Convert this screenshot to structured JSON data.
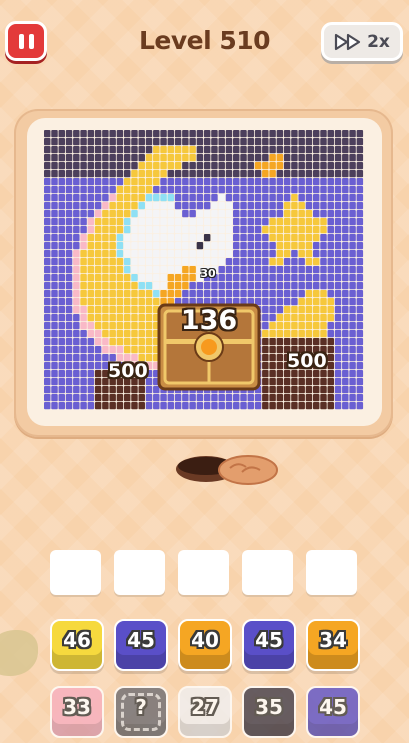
{
  "header": {
    "level_title": "Level 510",
    "speed_label": "2x",
    "pause_icon": "pause-icon",
    "speed_icon": "fast-forward-icon"
  },
  "board": {
    "palette": {
      "D": "#4c3f5c",
      "B": "#6a5fd2",
      "Y": "#f6c83c",
      "O": "#f5a623",
      "P": "#f9b9c7",
      "W": "#f4f4f6",
      "C": "#8fe0f4",
      "K": "#3a3348",
      "M": "#5a2f25",
      "G": "#d8a75a"
    },
    "rows": [
      "DDDDDDDDDDDDDDDDDDDDDDDDDDDDDDDDDDDDDDDDDDDD",
      "DDDDDDDDDDDDDDDDDDDDDDDDDDDDDDDDDDDDDDDDDDDD",
      "DDDDDDDDDDDDDDDYYYYYYDDDDDDDDDDDDDDDDDDDDDDD",
      "DDDDDDDDDDDDDDYYYYYYYDDDDDDDDDDOODDDDDDDDDDD",
      "DDDDDDDDDDDDDYYYYYYDDDDDDDDDDOOOODDDDDDDDDDD",
      "DDDDDDDDDDDDYYYYYDDDDDDDDDDDDDOODDDDDDDDDDDD",
      "BBBBBBBBBBBYYYYYBBBBBBBBBBBBBBBBBBBBBBBBBBBB",
      "BBBBBBBBBBYYYYYBBBBBBBBBBBBBBBBBBBBBBBBBBBBB",
      "BBBBBBBBBPYYYYCCCCBBBBBBWBBBBBBBBBYBBBBBBBBB",
      "BBBBBBBBPYYYYCWWWWBBBBBWWWBBBBBBBYYYBBBBBBBB",
      "BBBBBBBPYYYYCWWWWWWBBWWWWWBBBBBBBYYYYBBBBBBB",
      "BBBBBBPYYYYCWWWWWWWWWWWWWWBBBBBYYYYYYYYBBBBB",
      "BBBBBBPYYYYCWWWWWWWWWWWWWWBBBBYYYYYYYYYBBBBB",
      "BBBBBPYYYYCWWWWWWWWWWWKWWWBBBBBYYYYYYYBBBBBB",
      "BBBBBPYYYYCWWWWWWWWWWKWWWWBBBBBBYYYYYBBBBBBB",
      "BBBBPYYYYYCWWWWWWWWWWWWWWWBBBBBBYYBYYBBBBBBB",
      "BBBBPYYYYYYCWWWWWWWWWWWWWBBBBBBYYBBBYYBBBBBB",
      "BBBBPYYYYYYCWWWWWWWOOWWWBBBBBBBBBBBBBBBBBBBB",
      "BBBBPYYYYYYYCWWWWOOOOWBBBBBBBBBBBBBBBBBBBBBB",
      "BBBBPYYYYYYYYCCWWOOOBBBBBBBBBBBBBBBBBBBBBBBB",
      "BBBBPYYYYYYYYYYCOOOBBBBBBBBBBBBBBBBBYYYBBBBB",
      "BBBBPYYYYYYYYYYYOOBBBBBBBBBBBBBBBBBYYYYYBBBB",
      "BBBBPPYYYYYYYYYYYYBBBBBBBBBBBBBBBYYYYYYYBBBB",
      "BBBBBPYYYYYYYYYYYYBBBBBBBBBBBBBBYYYYYYYYBBBB",
      "BBBBBPPYYYYYYYYYYYBBBBBBBBBBBBBYYYYYYYYBBBBB",
      "BBBBBBPPYYYYYYYYYYBBBBBBBBBBBBYYYYYYYYYBBBBB",
      "BBBBBBBPPYYYYYYYYYBBBBBBBBBBBBMMMMMMMMMMBBBB",
      "BBBBBBBBPPPYYYYYYYBBBBBBBBBBBBMMMMMMMMMMBBBB",
      "BBBBBBBBBBPPPYYYYYBBBBBBBBBBBBMMMMMMMMMMBBBB",
      "BBBBBBBBBBBBPPPPYYBBBBBBBBBBBBMMMMMMMMMMBBBB",
      "BBBBBBBMMMMMMMBBBBBBBBBBBBBBBBMMMMMMMMMMBBBB",
      "BBBBBBBMMMMMMMBBBBBBBBBBBBBBBBMMMMMMMMMMBBBB",
      "BBBBBBBMMMMMMMBBBBBBBBBBBBBBBBMMMMMMMMMMBBBB",
      "BBBBBBBMMMMMMMBBBBBBBBBBBBBBBBMMMMMMMMMMBBBB",
      "BBBBBBBMMMMMMMBBBBBBBBBBBBBBBBMMMMMMMMMMBBBB"
    ],
    "small_count": "30",
    "chest_count": "136",
    "crate_left_count": "500",
    "crate_right_count": "500"
  },
  "hole_icon": "hole-icon",
  "slots": [
    "",
    "",
    "",
    "",
    ""
  ],
  "front_row": [
    {
      "count": "46",
      "color": "#f6d93e"
    },
    {
      "count": "45",
      "color": "#5a4fc8"
    },
    {
      "count": "40",
      "color": "#f5a623"
    },
    {
      "count": "45",
      "color": "#5a4fc8"
    },
    {
      "count": "34",
      "color": "#f5a623"
    }
  ],
  "back_row": [
    {
      "count": "33",
      "color": "#f7aec0"
    },
    {
      "count": "?",
      "color": "#6a6a70"
    },
    {
      "count": "27",
      "color": "#f0f0f2"
    },
    {
      "count": "35",
      "color": "#3f3a48"
    },
    {
      "count": "45",
      "color": "#5a4fc8"
    }
  ]
}
